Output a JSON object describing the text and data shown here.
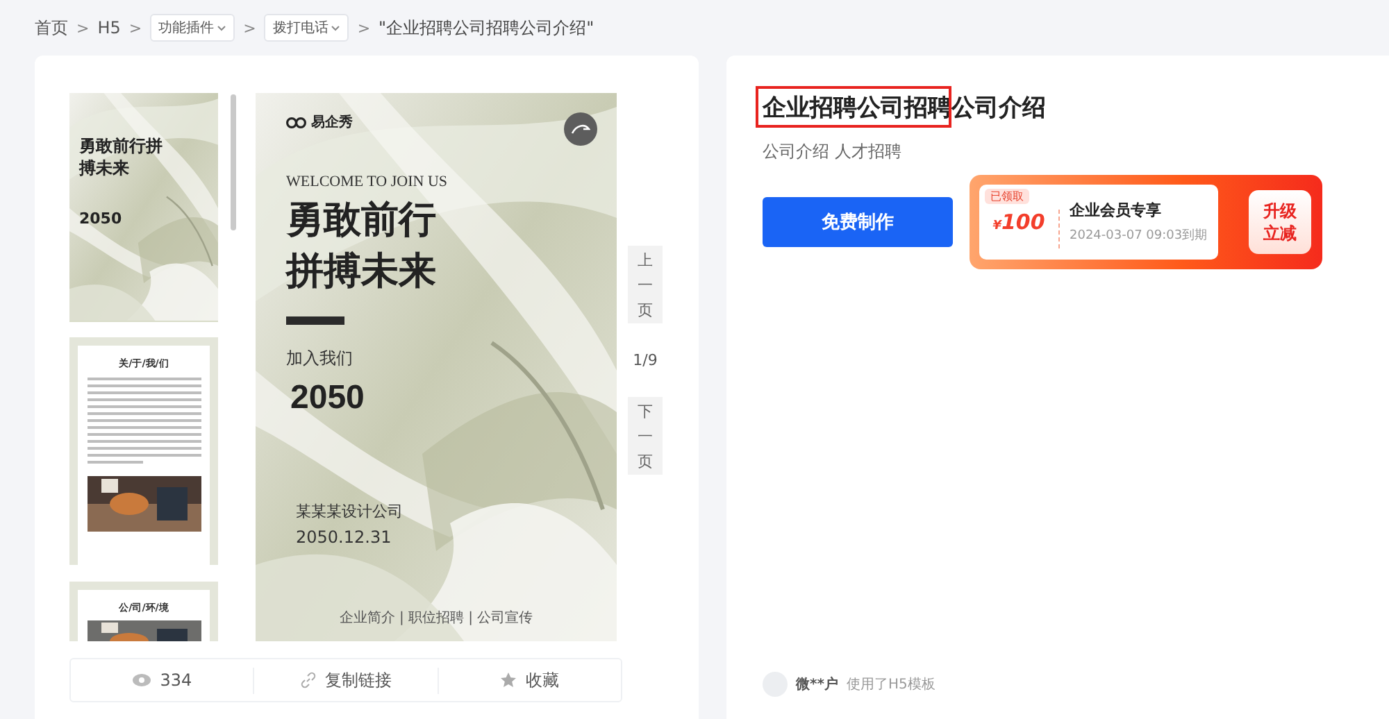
{
  "breadcrumb": [
    {
      "kind": "link",
      "label": "首页"
    },
    {
      "kind": "link",
      "separator": ">",
      "label": "H5"
    },
    {
      "kind": "dropdown",
      "separator": ">",
      "label": "功能插件"
    },
    {
      "kind": "dropdown",
      "separator": ">",
      "label": "拨打电话"
    },
    {
      "kind": "current",
      "separator": ">",
      "label": "\"企业招聘公司招聘公司介绍\""
    }
  ],
  "thumbnails": [
    {
      "kind": "cover",
      "selected": true,
      "lines": [
        "勇敢前行",
        "拼搏未来"
      ],
      "year": "2050"
    },
    {
      "kind": "article",
      "selected": false,
      "title": "关/于/我/们"
    },
    {
      "kind": "gallery",
      "selected": false,
      "title": "公/司/环/境"
    }
  ],
  "poster": {
    "brand": "易企秀",
    "welcome": "WELCOME TO JOIN US",
    "headline": [
      "勇敢前行",
      "拼搏未来"
    ],
    "join": "加入我们",
    "year": "2050",
    "company": "某某某设计公司",
    "date": "2050.12.31",
    "footer": "企业简介 | 职位招聘 | 公司宣传"
  },
  "pager": {
    "prev": "上一页",
    "page": "1/9",
    "next": "下一页"
  },
  "actions": [
    {
      "kind": "views",
      "label": "334"
    },
    {
      "kind": "link",
      "label": "复制链接"
    },
    {
      "kind": "favorite",
      "label": "收藏"
    }
  ],
  "detail": {
    "title": "企业招聘公司招聘公司介绍",
    "tags": [
      "公司介绍",
      "人才招聘"
    ],
    "make_button": "免费制作",
    "coupon": {
      "status": "已领取",
      "currency": "¥",
      "amount": "100",
      "name": "企业会员专享",
      "expiry": "2024-03-07 09:03到期",
      "upgrade": [
        "升级",
        "立减"
      ]
    },
    "user": {
      "name": "微**户",
      "action": "使用了H5模板"
    }
  }
}
